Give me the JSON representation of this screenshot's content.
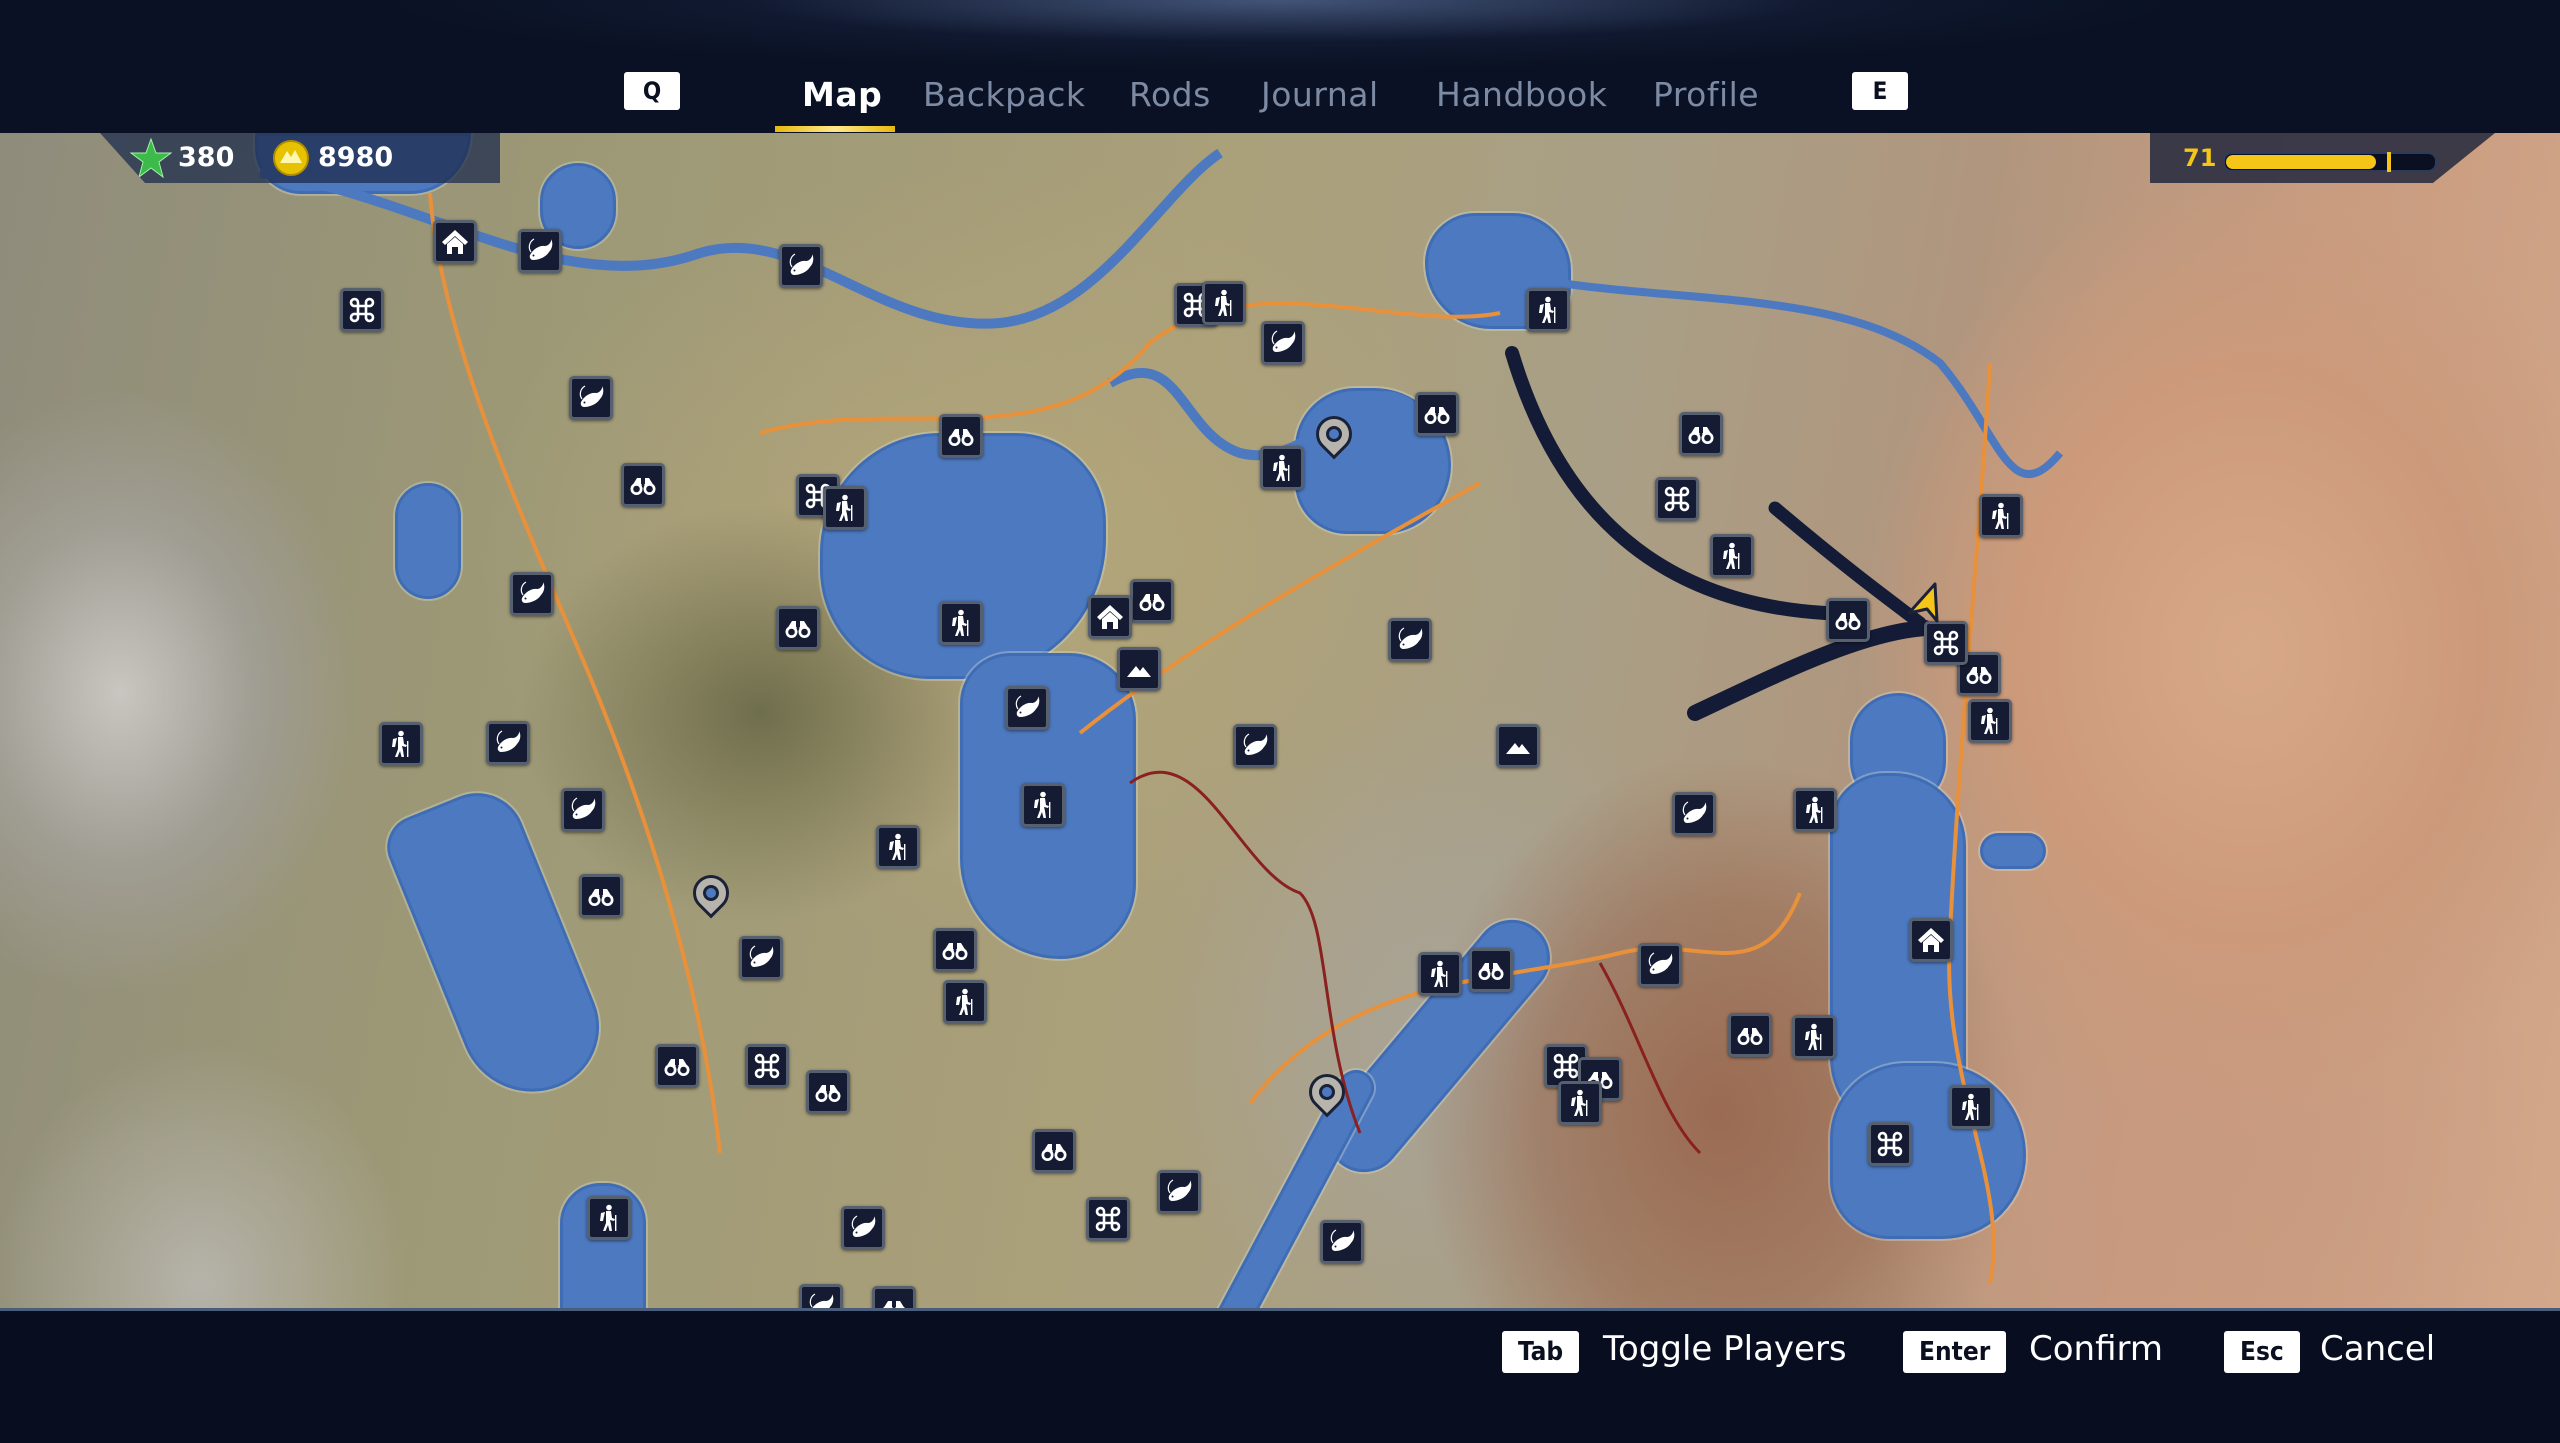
{
  "header": {
    "prev_key": "Q",
    "next_key": "E",
    "tabs": [
      {
        "label": "Map",
        "active": true
      },
      {
        "label": "Backpack",
        "active": false
      },
      {
        "label": "Rods",
        "active": false
      },
      {
        "label": "Journal",
        "active": false
      },
      {
        "label": "Handbook",
        "active": false
      },
      {
        "label": "Profile",
        "active": false
      }
    ]
  },
  "hud": {
    "stars": "380",
    "coins": "8980",
    "level": "71",
    "xp_progress_fraction": 0.72,
    "xp_marker_fraction": 0.78,
    "colors": {
      "accent": "#f5c518",
      "star": "#3dbb4a",
      "water": "#4d79c0",
      "panel": "#141b33"
    }
  },
  "map": {
    "poi_types": [
      "house",
      "binoculars",
      "fish",
      "hiker",
      "cmd",
      "mountain",
      "target"
    ],
    "player_marker": "player-arrow-icon"
  },
  "footer": {
    "hints": [
      {
        "key": "Tab",
        "label": "Toggle Players"
      },
      {
        "key": "Enter",
        "label": "Confirm"
      },
      {
        "key": "Esc",
        "label": "Cancel"
      }
    ]
  }
}
